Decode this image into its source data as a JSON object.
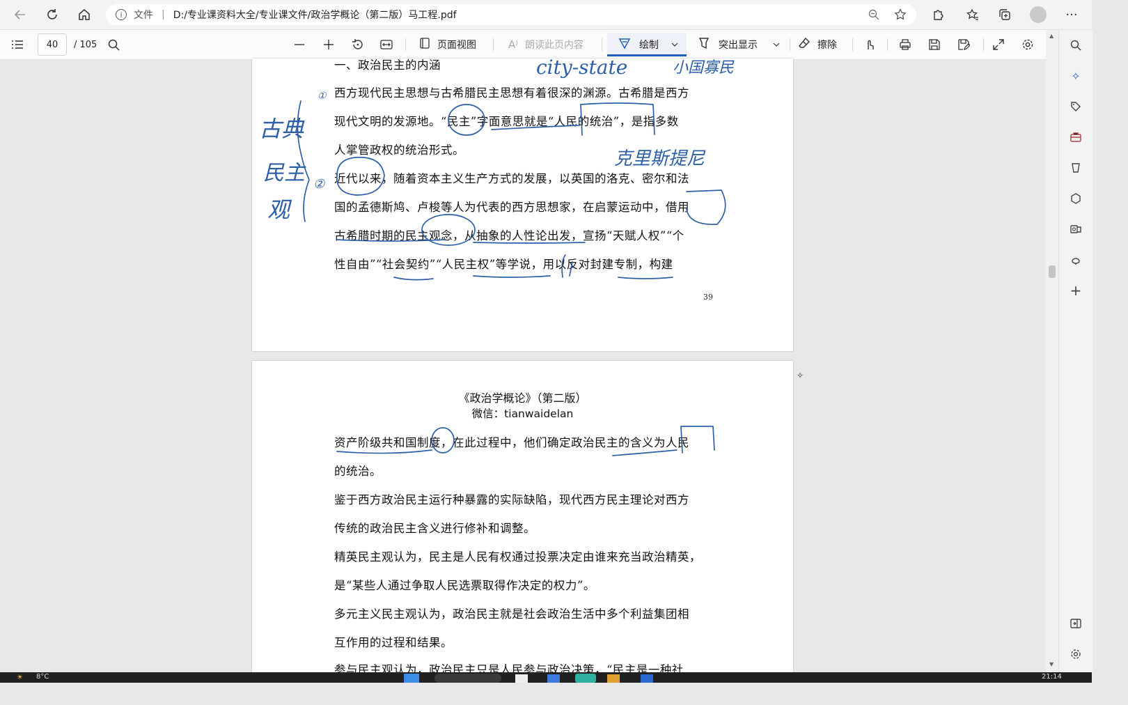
{
  "browser": {
    "scheme_label": "文件",
    "address": "D:/专业课资料大全/专业课文件/政治学概论（第二版）马工程.pdf"
  },
  "toolbar": {
    "page_current": "40",
    "page_total": "/ 105",
    "page_view": "页面视图",
    "read_aloud": "朗读此页内容",
    "draw": "绘制",
    "highlight": "突出显示",
    "erase": "擦除"
  },
  "page1": {
    "heading": "一、政治民主的内涵",
    "lines": [
      "西方现代民主思想与古希腊民主思想有着很深的渊源。古希腊是西方",
      "现代文明的发源地。“民主”字面意思就是“人民的统治”，是指多数",
      "人掌管政权的统治形式。",
      "近代以来，随着资本主义生产方式的发展，以英国的洛克、密尔和法",
      "国的孟德斯鸠、卢梭等人为代表的西方思想家，在启蒙运动中，借用",
      "古希腊时期的民主观念，从抽象的人性论出发，宣扬“天赋人权”“个",
      "性自由”“社会契约”“人民主权”等学说，用以反对封建专制，构建"
    ],
    "page_number": "39"
  },
  "page2": {
    "book_title": "《政治学概论》（第二版）",
    "wechat": "微信：tianwaidelan",
    "lines": [
      "资产阶级共和国制度，在此过程中，他们确定政治民主的含义为人民",
      "的统治。",
      "鉴于西方政治民主运行种暴露的实际缺陷，现代西方民主理论对西方",
      "传统的政治民主含义进行修补和调整。",
      "精英民主观认为，民主是人民有权通过投票决定由谁来充当政治精英，",
      "是“某些人通过争取人民选票取得作决定的权力”。",
      "多元主义民主观认为，政治民主就是社会政治生活中多个利益集团相",
      "互作用的过程和结果。",
      "参与民主观认为，政治民主只是人民参与政治决策，“民主是一种社"
    ]
  },
  "annotations": {
    "city_state": "city-state",
    "small_state": "小国寡民",
    "gudian": "古典",
    "minzhu": "民主",
    "guan": "观",
    "kleisthenes": "克里斯提尼",
    "num1": "①",
    "num2": "②"
  },
  "taskbar": {
    "temp": "8°C",
    "time": "21:14"
  }
}
